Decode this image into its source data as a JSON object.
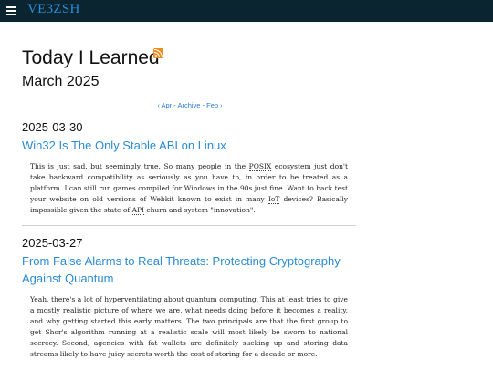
{
  "header": {
    "site_name": "VE3ZSH",
    "menu_icon": "hamburger-menu-icon"
  },
  "page": {
    "title": "Today I Learned",
    "rss_icon": "rss-feed-icon",
    "month": "March 2025"
  },
  "month_nav": {
    "prev": "‹ Apr",
    "sep1": " - ",
    "archive": "Archive",
    "sep2": " - ",
    "next": "Feb ›"
  },
  "posts": [
    {
      "date": "2025-03-30",
      "title": "Win32 Is The Only Stable ABI on Linux",
      "body": {
        "p1": "This is just sad, but seemingly true. So many people in the ",
        "abbr1": "POSIX",
        "p2": " ecosystem just don't take backward compatibility as seriously as you have to, in order to be treated as a platform. I can still run games compiled for Windows in the 90s just fine. Want to back test your website on old versions of Webkit known to exist in many ",
        "abbr2": "IoT",
        "p3": " devices? Basically impossible given the state of ",
        "abbr3": "API",
        "p4": " churn and system \"innovation\"."
      }
    },
    {
      "date": "2025-03-27",
      "title": "From False Alarms to Real Threats: Protecting Cryptography Against Quantum",
      "body": "Yeah, there's a lot of hyperventilating about quantum computing. This at least tries to give a mostly realistic picture of where we are, what needs doing before it becomes a reality, and why getting started this early matters. The two principals are that the first group to get Shor's algorithm running at a realistic scale will most likely be sworn to national secrecy. Second, agencies with fat wallets are definitely sucking up and storing data streams likely to have juicy secrets worth the cost of storing for a decade or more."
    }
  ]
}
